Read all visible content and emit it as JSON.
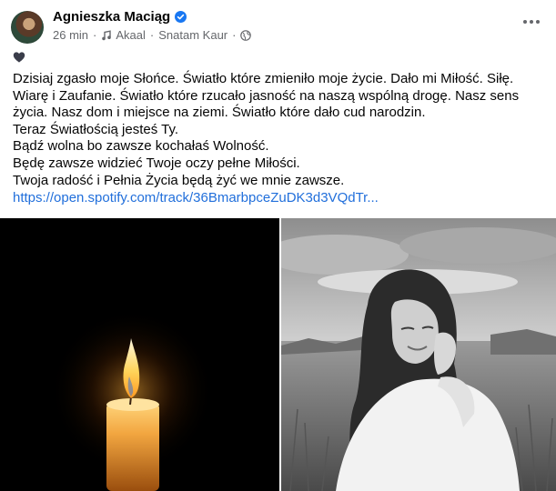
{
  "post": {
    "author": "Agnieszka Maciąg",
    "time": "26 min",
    "song": "Akaal",
    "artist": "Snatam Kaur",
    "separator": "·",
    "emoji": "black-heart",
    "paragraphs": [
      "Dzisiaj zgasło moje Słońce. Światło które zmieniło moje życie. Dało mi Miłość. Siłę. Wiarę i Zaufanie. Światło które rzucało jasność na naszą wspólną drogę. Nasz sens życia. Nasz dom i miejsce na ziemi. Światło które dało cud narodzin.",
      "Teraz Światłością jesteś Ty.",
      "Bądź wolna bo zawsze kochałaś Wolność.",
      "Będę zawsze widzieć Twoje oczy pełne Miłości.",
      "Twoja radość i Pełnia Życia będą żyć we mnie zawsze."
    ],
    "link": "https://open.spotify.com/track/36BmarbpceZuDK3d3VQdTr..."
  },
  "colors": {
    "link": "#216fdb",
    "meta": "#65676b",
    "verified": "#1877f2"
  },
  "icons": [
    "verified-badge-icon",
    "music-note-icon",
    "globe-icon",
    "more-options-icon"
  ]
}
